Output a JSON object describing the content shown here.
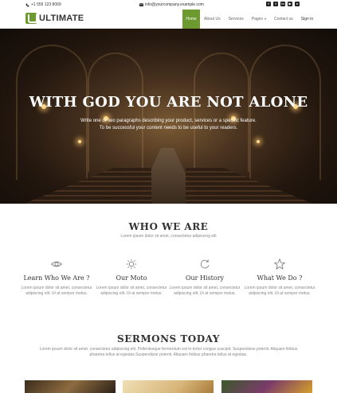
{
  "topbar": {
    "phone": "+1 555 123 8069",
    "email": "info@yourcompany.example.com",
    "social_icons": [
      "facebook-icon",
      "twitter-icon",
      "linkedin-icon",
      "youtube-icon",
      "github-icon"
    ]
  },
  "navbar": {
    "brand": "ULTIMATE",
    "items": [
      {
        "label": "Home"
      },
      {
        "label": "About Us"
      },
      {
        "label": "Services"
      },
      {
        "label": "Pages"
      },
      {
        "label": "Contact us"
      },
      {
        "label": "Sign in"
      }
    ],
    "accent": "#6c9a2f"
  },
  "hero": {
    "title": "WITH GOD YOU ARE NOT ALONE",
    "text": "Write one or two paragraphs describing your product, services or a specific feature. To be successful your content needs to be useful to your readers."
  },
  "who": {
    "title": "WHO WE ARE",
    "subtitle": "Lorem ipsum dolor sit amet, consectetur adipiscing elit",
    "features": [
      {
        "icon": "eye-icon",
        "title": "Learn Who We Are ?",
        "text": "Lorem ipsum dolor sit amet, consectetur adipiscing elit. Ut at semper metus."
      },
      {
        "icon": "sun-icon",
        "title": "Our Moto",
        "text": "Lorem ipsum dolor sit amet, consectetur adipiscing elit. Ut at semper metus."
      },
      {
        "icon": "refresh-icon",
        "title": "Our History",
        "text": "Lorem ipsum dolor sit amet, consectetur adipiscing elit. Ut at semper metus."
      },
      {
        "icon": "star-icon",
        "title": "What We Do ?",
        "text": "Lorem ipsum dolor sit amet, consectetur adipiscing elit. Ut at semper metus."
      }
    ]
  },
  "sermons": {
    "title": "SERMONS TODAY",
    "text": "Lorem ipsum dolor sit amet, consectetur adipiscing elit. Pellentesque fermentum est in tortor congue suscipit. Suspendisse potenti. Aliquam finibus pharetra tellus at egestas.Suspendisse potenti. Aliquam finibus pharetra tellus at egestas."
  }
}
